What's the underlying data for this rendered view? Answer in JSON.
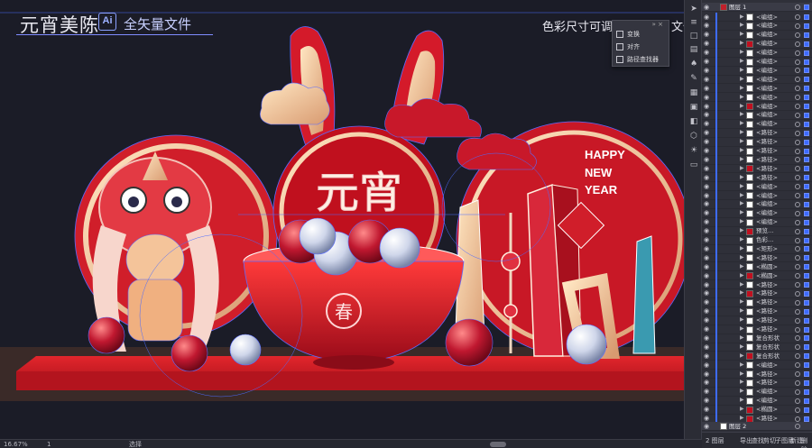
{
  "header": {
    "title": "元宵美陈",
    "ai_badge": "Ai",
    "subtitle": "全矢量文件",
    "right_note": "色彩尺寸可调",
    "right_note_2": "文件"
  },
  "artwork": {
    "center_text": "元宵",
    "greeting": [
      "HAPPY",
      "NEW",
      "YEAR"
    ],
    "bowl_seal": "春"
  },
  "float_menu": {
    "top_glyph": "» ×",
    "items": [
      "变换",
      "对齐",
      "路径查找器"
    ]
  },
  "toolbar": {
    "icons": [
      "arrow-icon",
      "layers-icon",
      "transform-icon",
      "align-icon",
      "spade-icon",
      "brush-icon",
      "swatch-icon",
      "grid-icon",
      "gradient-icon",
      "cube-icon",
      "sun-icon",
      "type-icon"
    ]
  },
  "layers_panel": {
    "top_layer": "图层 1",
    "rows": [
      "<编组>",
      "<编组>",
      "<编组>",
      "<编组>",
      "<编组>",
      "<编组>",
      "<编组>",
      "<编组>",
      "<编组>",
      "<编组>",
      "<编组>",
      "<编组>",
      "<编组>",
      "<路径>",
      "<路径>",
      "<路径>",
      "<路径>",
      "<路径>",
      "<路径>",
      "<编组>",
      "<编组>",
      "<编组>",
      "<编组>",
      "<编组>",
      "预览…",
      "色彩…",
      "<矩形>",
      "<路径>",
      "<椭圆>",
      "<椭圆>",
      "<路径>",
      "<路径>",
      "<路径>",
      "<路径>",
      "<路径>",
      "<路径>",
      "复合形状",
      "复合形状",
      "复合形状",
      "<编组>",
      "<路径>",
      "<路径>",
      "<编组>",
      "<编组>",
      "<椭圆>",
      "<路径>"
    ],
    "bottom_layer": "图层 2"
  },
  "layers_footer": {
    "label": "2 图层",
    "actions": [
      "导出",
      "查找",
      "剪切",
      "子图层",
      "新建",
      "删除"
    ]
  },
  "statusbar": {
    "zoom": "16.67%",
    "page": "1",
    "tool": "选择"
  },
  "colors": {
    "background": "#1b1c27",
    "red_primary": "#d0202c",
    "gold": "#f2d0a0",
    "selection_blue": "#4c6cff"
  }
}
